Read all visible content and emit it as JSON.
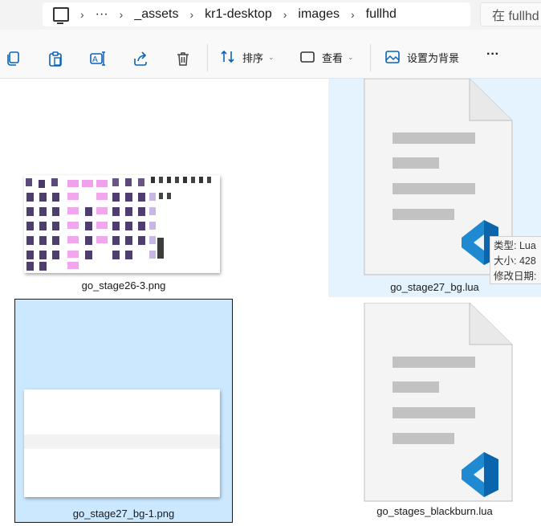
{
  "address": {
    "crumbs": [
      "···",
      "_assets",
      "kr1-desktop",
      "images",
      "fullhd"
    ],
    "search_placeholder": "在 fullhd"
  },
  "toolbar": {
    "sort_label": "排序",
    "view_label": "查看",
    "set_bg_label": "设置为背景",
    "more_label": "···"
  },
  "files": [
    {
      "name": "go_stage26-3.png"
    },
    {
      "name": "go_stage27_bg.lua"
    },
    {
      "name": "go_stage27_bg-1.png"
    },
    {
      "name": "go_stages_blackburn.lua"
    }
  ],
  "tooltip": {
    "type_line": "类型: Lua",
    "size_line": "大小: 428",
    "date_line": "修改日期:"
  },
  "colors": {
    "accent": "#0078d4",
    "hover_bg": "#e5f3ff",
    "selected_bg": "#cce8ff",
    "vscode_blue": "#1f8ad2"
  }
}
